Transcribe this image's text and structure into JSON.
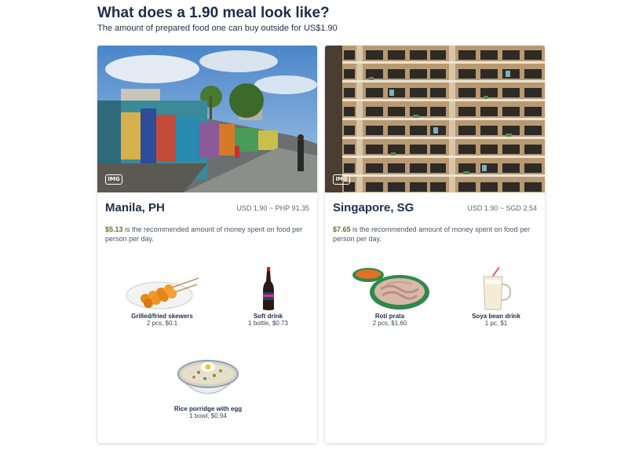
{
  "header": {
    "title": "What does a 1.90 meal look like?",
    "subtitle": "The amount of prepared food one can buy outside for US$1.90"
  },
  "badge_label": "IMG",
  "cards": [
    {
      "city": "Manila, PH",
      "rate": "USD 1.90 ~ PHP 91.35",
      "amount": "$5.13",
      "note": "is the recommended amount of money spent on food per person per day.",
      "foods": [
        {
          "name": "Grilled/fried skewers",
          "qty": "2 pcs, $0.1",
          "icon": "skewers-icon"
        },
        {
          "name": "Soft drink",
          "qty": "1 bottle, $0.73",
          "icon": "soda-bottle-icon"
        },
        {
          "name": "Rice porridge with egg",
          "qty": "1 bowl, $0.94",
          "icon": "porridge-bowl-icon"
        }
      ]
    },
    {
      "city": "Singapore, SG",
      "rate": "USD 1.90 ~ SGD 2.54",
      "amount": "$7.65",
      "note": "is the recommended amount of money spent on food per person per day.",
      "foods": [
        {
          "name": "Roti prata",
          "qty": "2 pcs, $1.60",
          "icon": "roti-prata-icon"
        },
        {
          "name": "Soya bean drink",
          "qty": "1 pc, $1",
          "icon": "soya-drink-icon"
        }
      ]
    }
  ]
}
